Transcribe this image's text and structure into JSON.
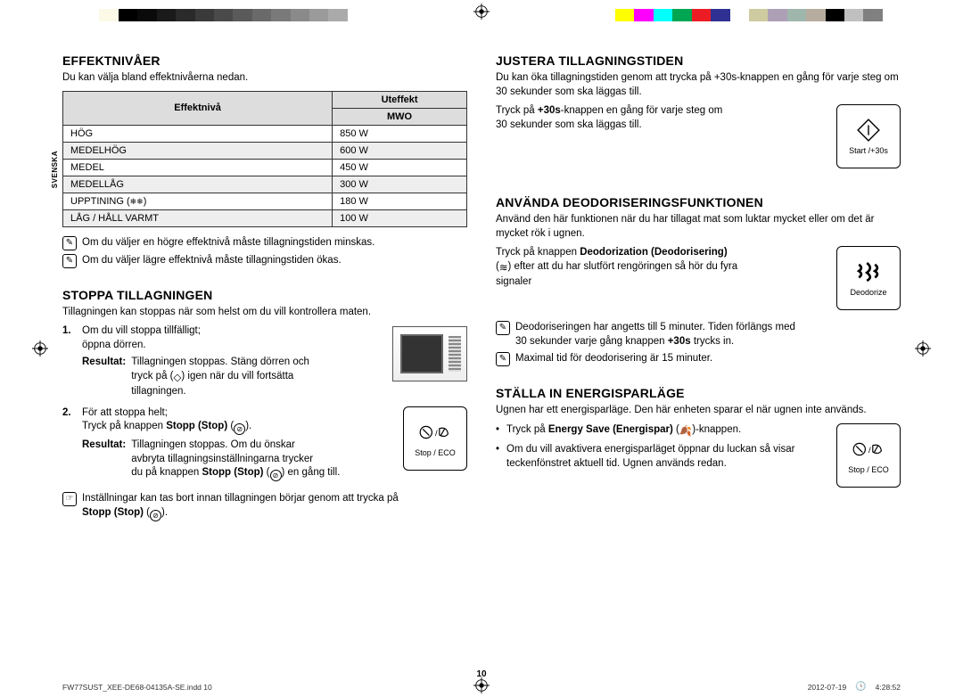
{
  "meta": {
    "language_tab": "SVENSKA",
    "page_number": "10",
    "footer_file": "FW77SUST_XEE-DE68-04135A-SE.indd   10",
    "footer_date": "2012-07-19",
    "footer_time": "4:28:52"
  },
  "colorbars": {
    "left": [
      "#ffffff",
      "#fcf9e6",
      "#000000",
      "#0a0a0a",
      "#1a1a1a",
      "#2a2a2a",
      "#3a3a3a",
      "#4a4a4a",
      "#5a5a5a",
      "#6a6a6a",
      "#7a7a7a",
      "#8a8a8a",
      "#9a9a9a",
      "#aaaaaa"
    ],
    "right": [
      "#ffff00",
      "#ff00ff",
      "#00ffff",
      "#00a651",
      "#ed1c24",
      "#2e3192",
      "#ffffff",
      "#cfcba0",
      "#ad9fb6",
      "#9fb6ad",
      "#b6ad9f",
      "#000000",
      "#c0c0c0",
      "#808080"
    ]
  },
  "left_col": {
    "s1": {
      "title": "EFFEKTNIVÅER",
      "intro": "Du kan välja bland effektnivåerna nedan.",
      "table": {
        "head_level": "Effektnivå",
        "head_out": "Uteffekt",
        "head_mwo": "MWO",
        "rows": [
          {
            "level": "HÖG",
            "val": "850 W"
          },
          {
            "level": "MEDELHÖG",
            "val": "600 W"
          },
          {
            "level": "MEDEL",
            "val": "450 W"
          },
          {
            "level": "MEDELLÅG",
            "val": "300 W"
          },
          {
            "level": "UPPTINING",
            "defrost": true,
            "val": "180 W"
          },
          {
            "level": "LÅG / HÅLL VARMT",
            "val": "100 W"
          }
        ]
      },
      "note1": "Om du väljer en högre effektnivå måste tillagningstiden minskas.",
      "note2": "Om du väljer lägre effektnivå måste tillagningstiden ökas."
    },
    "s2": {
      "title": "STOPPA TILLAGNINGEN",
      "intro": "Tillagningen kan stoppas när som helst om du vill kontrollera maten.",
      "step1_a": "Om du vill stoppa tillfälligt;",
      "step1_b": "öppna dörren.",
      "step1_res_label": "Resultat:",
      "step1_res_a": "Tillagningen stoppas. Stäng dörren och",
      "step1_res_b": "tryck på (",
      "step1_res_c": ") igen när du vill fortsätta",
      "step1_res_d": "tillagningen.",
      "step2_a": "För att stoppa helt;",
      "step2_b_pre": "Tryck på knappen ",
      "step2_b_bold": "Stopp (Stop)",
      "step2_b_post": " (",
      "step2_b_end": ").",
      "step2_res_label": "Resultat:",
      "step2_res_a": "Tillagningen stoppas. Om du önskar",
      "step2_res_b": "avbryta tillagningsinställningarna trycker",
      "step2_res_c_pre": "du på knappen ",
      "step2_res_c_bold": "Stopp (Stop)",
      "step2_res_c_mid": " (",
      "step2_res_c_end": ") en gång till.",
      "note_pre": "Inställningar kan tas bort innan tillagningen börjar genom att trycka på",
      "note_bold": "Stopp (Stop)",
      "note_mid": " (",
      "note_end": ").",
      "icon_label": "Stop / ECO"
    }
  },
  "right_col": {
    "s1": {
      "title": "JUSTERA TILLAGNINGSTIDEN",
      "intro": "Du kan öka tillagningstiden genom att trycka på +30s-knappen en gång för varje steg om 30 sekunder som ska läggas till.",
      "body_a": "Tryck på ",
      "body_bold": "+30s",
      "body_b": "-knappen en gång för varje steg om",
      "body_c": "30 sekunder som ska läggas till.",
      "icon_label": "Start /+30s"
    },
    "s2": {
      "title": "ANVÄNDA DEODORISERINGSFUNKTIONEN",
      "intro": "Använd den här funktionen när du har tillagat mat som luktar mycket eller om det är mycket rök i ugnen.",
      "body_a_pre": "Tryck på knappen ",
      "body_a_bold": "Deodorization (Deodorisering)",
      "body_b": "efter att du har slutfört rengöringen så hör du fyra",
      "body_c": "signaler",
      "note1_a": "Deodoriseringen har angetts till 5 minuter. Tiden förlängs med",
      "note1_b_pre": "30 sekunder varje gång knappen ",
      "note1_b_bold": "+30s",
      "note1_b_post": " trycks in.",
      "note2": "Maximal tid för deodorisering är 15 minuter.",
      "icon_label": "Deodorize"
    },
    "s3": {
      "title": "STÄLLA IN ENERGISPARLÄGE",
      "intro": "Ugnen har ett energisparläge. Den här enheten sparar el när ugnen inte används.",
      "b1_pre": "Tryck på ",
      "b1_bold": "Energy Save (Energispar)",
      "b1_mid": " (",
      "b1_end": ")-knappen.",
      "b2": "Om du vill avaktivera energisparläget öppnar du luckan så visar teckenfönstret aktuell tid. Ugnen används redan.",
      "icon_label": "Stop / ECO"
    }
  }
}
